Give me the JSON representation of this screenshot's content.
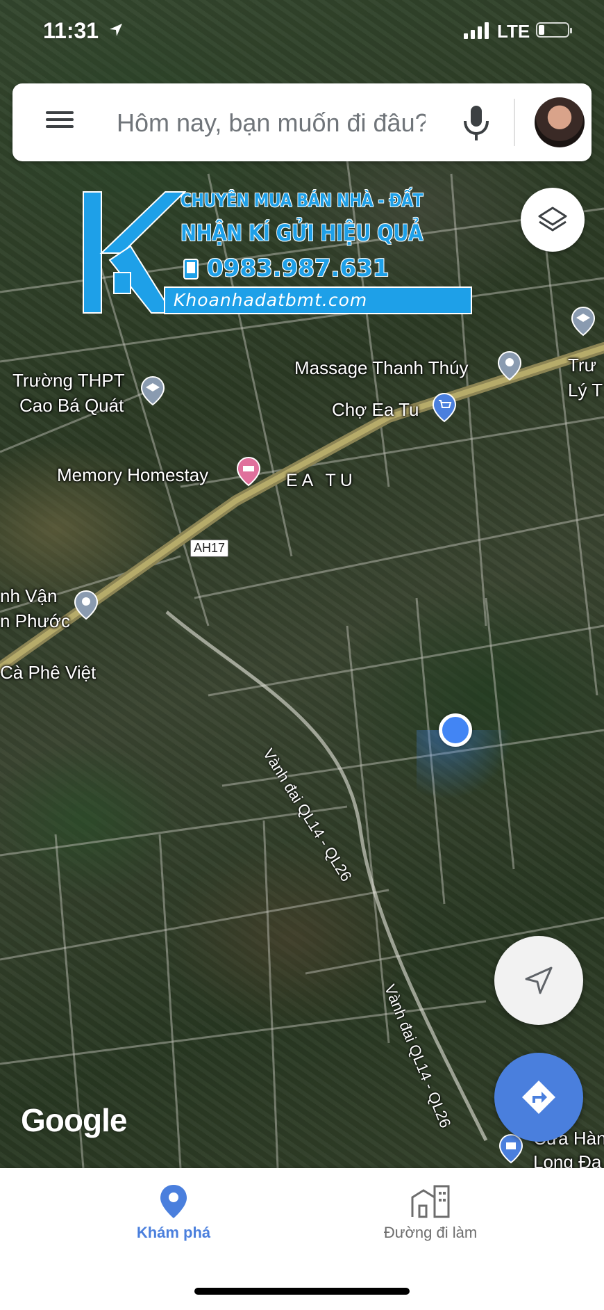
{
  "status_bar": {
    "time": "11:31",
    "network": "LTE"
  },
  "search": {
    "placeholder": "Hôm nay, bạn muốn đi đâu?"
  },
  "watermark": {
    "line1": "CHUYÊN MUA BÁN NHÀ - ĐẤT",
    "line2": "NHẬN KÍ GỬI HIỆU QUẢ",
    "phone": "0983.987.631",
    "website": "Khoanhadatbmt.com",
    "color": "#1ea0e8"
  },
  "map": {
    "places": {
      "massage": "Massage Thanh Thúy",
      "school_1": "Trường THPT",
      "school_2": "Cao Bá Quát",
      "market": "Chợ Ea Tu",
      "homestay": "Memory Homestay",
      "area": "EA TU",
      "road_shield": "AH17",
      "van_1": "nh Vận",
      "van_2": "n Phước",
      "cafe": "Cà Phê Việt",
      "school_right_1": "Trư",
      "school_right_2": "Lý T",
      "store_1": "Cửa Hàn",
      "store_2": "Long Đạ"
    },
    "roads": {
      "ring_road_1": "Vành đai QL14 - QL26",
      "ring_road_2": "Vành đai QL14 - QL26"
    },
    "attribution": "Google",
    "colors": {
      "location_dot": "#4285f4",
      "directions_button": "#4a7fdd"
    }
  },
  "bottom_nav": {
    "tabs": [
      {
        "label": "Khám phá",
        "icon": "location-pin-icon",
        "active": true
      },
      {
        "label": "Đường đi làm",
        "icon": "commute-buildings-icon",
        "active": false
      }
    ],
    "active_color": "#4a7fdd"
  }
}
